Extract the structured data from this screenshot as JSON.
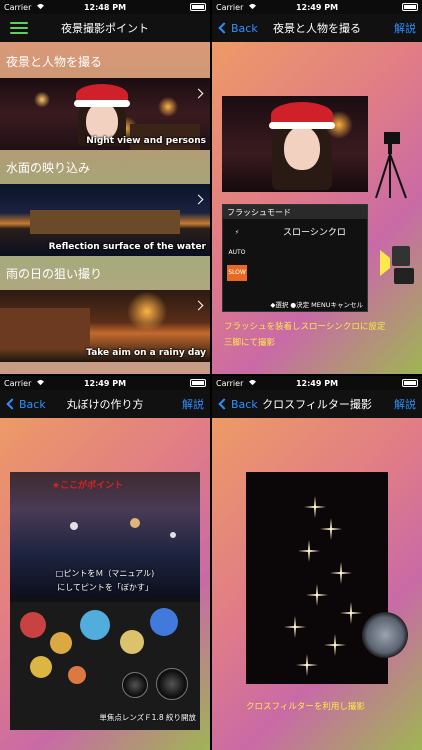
{
  "status": {
    "carrier": "Carrier",
    "time_p1": "12:48 PM",
    "time_p2": "12:49 PM",
    "time_p3": "12:49 PM",
    "time_p4": "12:49 PM"
  },
  "panel1": {
    "title": "夜景撮影ポイント",
    "sections": [
      {
        "title": "夜景と人物を撮る",
        "caption": "Night view and persons"
      },
      {
        "title": "水面の映り込み",
        "caption": "Reflection surface of the water"
      },
      {
        "title": "雨の日の狙い撮り",
        "caption": "Take aim on a rainy day"
      }
    ],
    "next_title": "丸ぼけの作り方"
  },
  "panel2": {
    "back": "Back",
    "title": "夜景と人物を撮る",
    "right": "解説",
    "screen_header": "フラッシュモード",
    "screen_mode": "スローシンクロ",
    "screen_icons": [
      "⚡",
      "AUTO",
      "⚡",
      "SLOW"
    ],
    "screen_footer": "◆選択 ●決定 MENUキャンセル",
    "note_line1": "フラッシュを装着しスローシンクロに設定",
    "note_line2": "三脚にて撮影"
  },
  "panel3": {
    "back": "Back",
    "title": "丸ぼけの作り方",
    "right": "解説",
    "point_label": "★ここがポイント",
    "text_line1": "□ピントをＭ（マニュアル)",
    "text_line2": "にしてピントを「ぼかす」",
    "lens_caption": "単焦点レンズＦ1.8 絞り開放"
  },
  "panel4": {
    "back": "Back",
    "title": "クロスフィルター撮影",
    "right": "解説",
    "caption": "クロスフィルターを利用し撮影"
  },
  "colors": {
    "accent_blue": "#2f8fff",
    "menu_green": "#5fd05f",
    "note_yellow": "#ffe94a",
    "point_red": "#e02020"
  }
}
